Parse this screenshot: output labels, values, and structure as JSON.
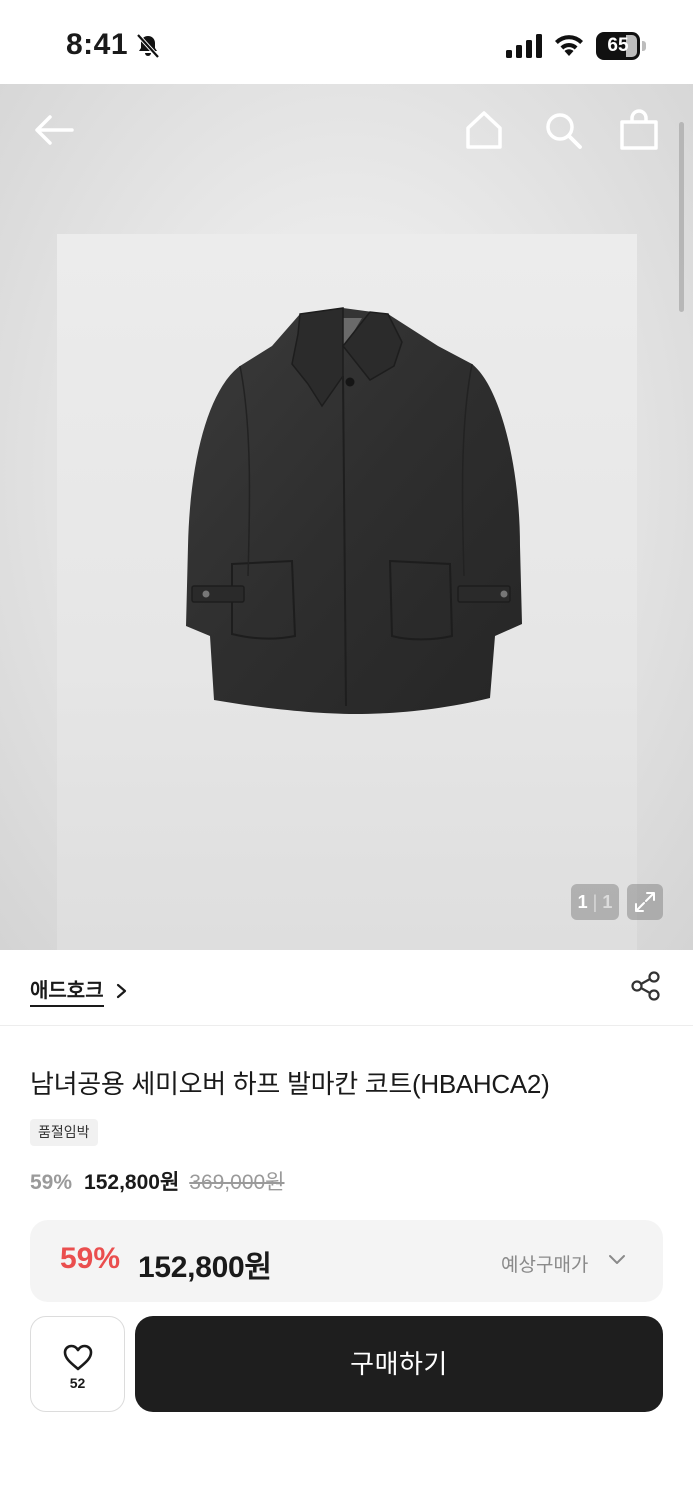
{
  "status_bar": {
    "time": "8:41",
    "battery_level": "65",
    "icons": [
      "bell-slash-icon",
      "cellular-signal-icon",
      "wifi-icon",
      "battery-icon"
    ]
  },
  "hero": {
    "icons": [
      "back-arrow-icon",
      "home-icon",
      "search-icon",
      "shopping-bag-icon",
      "expand-icon"
    ],
    "page_current": "1",
    "page_total": "1"
  },
  "brand": {
    "name": "애드호크",
    "icons": [
      "chevron-right-icon",
      "share-icon"
    ]
  },
  "product": {
    "title": "남녀공용 세미오버 하프 발마칸 코트(HBAHCA2)",
    "stock_badge": "품절임박",
    "discount_rate": "59%",
    "sale_price": "152,800원",
    "original_price": "369,000원"
  },
  "expected_price": {
    "discount_rate": "59%",
    "price": "152,800원",
    "label": "예상구매가"
  },
  "actions": {
    "like_count": "52",
    "buy_label": "구매하기"
  },
  "colors": {
    "discount_red": "#ea4e4e",
    "buy_button": "#1e1e1e",
    "muted_text": "#9a9a9a"
  }
}
